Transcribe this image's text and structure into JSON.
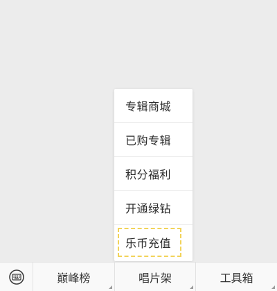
{
  "menu": {
    "items": [
      {
        "label": "专辑商城"
      },
      {
        "label": "已购专辑"
      },
      {
        "label": "积分福利"
      },
      {
        "label": "开通绿钻"
      },
      {
        "label": "乐币充值"
      }
    ]
  },
  "bottom_bar": {
    "keyboard_icon": "keyboard-icon",
    "tabs": [
      {
        "label": "巅峰榜"
      },
      {
        "label": "唱片架"
      },
      {
        "label": "工具箱"
      }
    ]
  }
}
